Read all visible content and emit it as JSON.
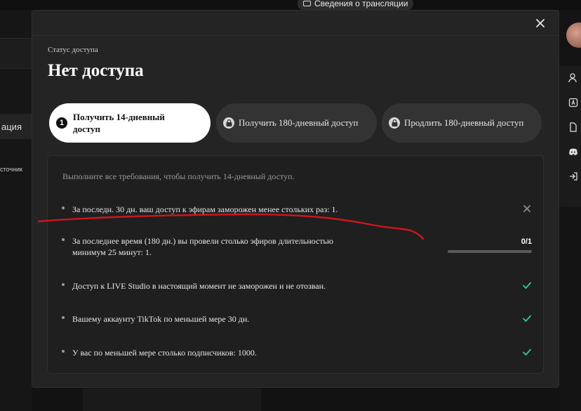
{
  "background": {
    "top_button": "Сведения о трансляции",
    "left_item_1": "ация",
    "left_item_2": "сточник"
  },
  "modal": {
    "status_label": "Статус доступа",
    "title": "Нет доступа",
    "tabs": [
      {
        "number": "1",
        "line1": "Получить 14-дневный",
        "line2": "доступ"
      },
      {
        "label": "Получить 180-дневный доступ"
      },
      {
        "label": "Продлить 180-дневный доступ"
      }
    ],
    "requirements_intro": "Выполните все требования, чтобы получить 14-дневный доступ.",
    "requirements": [
      {
        "text": "За последн. 30 дн. ваш доступ к эфирам заморожен менее стольких раз: 1.",
        "status": "failed"
      },
      {
        "text_line1": "За последнее время (180 дн.) вы провели столько эфиров длительностью",
        "text_line2": "минимум 25 минут: 1.",
        "status": "progress",
        "progress": "0/1",
        "progress_fraction": 0
      },
      {
        "text": "Доступ к LIVE Studio в настоящий момент не заморожен и не отозван.",
        "status": "passed"
      },
      {
        "text": "Вашему аккаунту TikTok по меньшей мере 30 дн.",
        "status": "passed"
      },
      {
        "text": "У вас по меньшей мере столько подписчиков: 1000.",
        "status": "passed"
      }
    ]
  },
  "colors": {
    "check": "#2ec4a0",
    "fail": "#8a8a8a",
    "annotation": "#d0161b"
  }
}
